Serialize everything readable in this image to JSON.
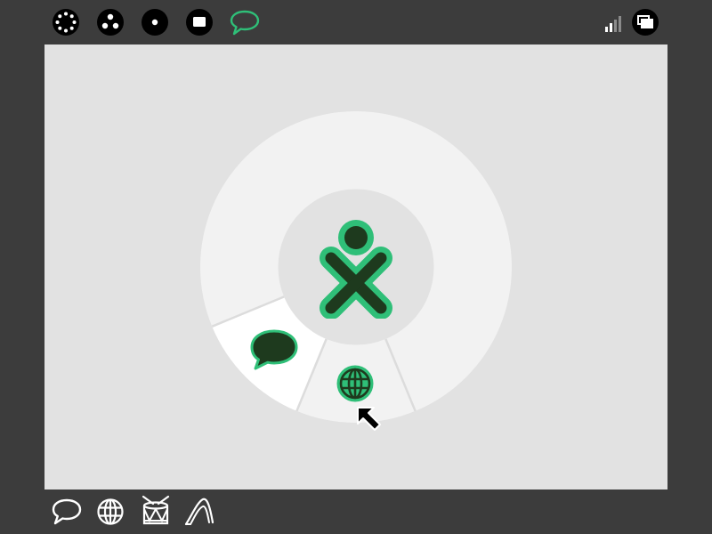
{
  "colors": {
    "frame": "#3c3c3c",
    "canvas": "#e2e2e2",
    "ring": "#f2f2f2",
    "selected_slice": "#ffffff",
    "center_circle": "#e2e2e2",
    "xo_stroke": "#2fbf78",
    "xo_fill": "#1e3a1e",
    "icon_white": "#ffffff"
  },
  "top_bar": {
    "zoom_levels": [
      {
        "icon": "neighborhood-view-icon"
      },
      {
        "icon": "group-view-icon"
      },
      {
        "icon": "home-view-icon"
      },
      {
        "icon": "activity-view-icon"
      }
    ],
    "current_activity": {
      "icon": "chat-activity-icon",
      "active": true
    },
    "device_tray": [
      {
        "icon": "wireless-signal-icon"
      },
      {
        "icon": "window-switch-icon"
      }
    ]
  },
  "home_view": {
    "owner_icon": "xo-buddy-icon",
    "favorites_ring": [
      {
        "icon": "chat-bubble-icon",
        "selected": true
      },
      {
        "icon": "browse-globe-icon",
        "selected": false,
        "hovered": true
      }
    ]
  },
  "activity_tray": [
    {
      "icon": "chat-activity-icon"
    },
    {
      "icon": "browse-activity-icon"
    },
    {
      "icon": "tamtam-drum-icon"
    },
    {
      "icon": "turtle-art-icon"
    }
  ]
}
